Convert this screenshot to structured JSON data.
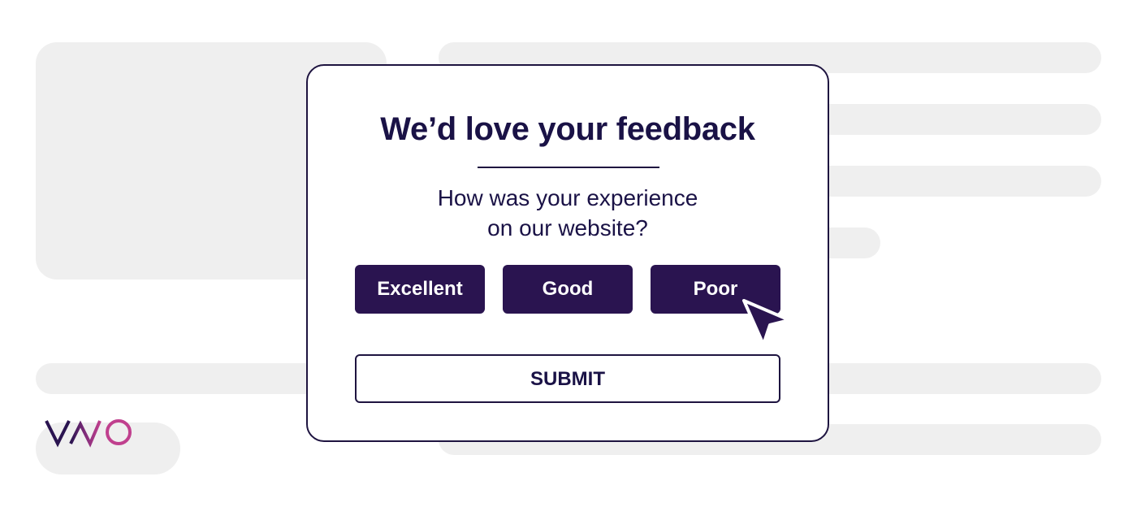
{
  "colors": {
    "primary": "#2a1450",
    "text": "#1a1246",
    "border": "#1e1440",
    "placeholder": "#efefef",
    "logo_dark": "#2a1450",
    "logo_accent": "#c0408e"
  },
  "logo": {
    "text": "VWO"
  },
  "modal": {
    "title": "We’d love your feedback",
    "question_line1": "How was your experience",
    "question_line2": "on our website?",
    "options": {
      "excellent": "Excellent",
      "good": "Good",
      "poor": "Poor"
    },
    "submit_label": "SUBMIT"
  },
  "cursor": {
    "icon": "arrow-pointer-icon",
    "hovering_on": "Poor"
  }
}
